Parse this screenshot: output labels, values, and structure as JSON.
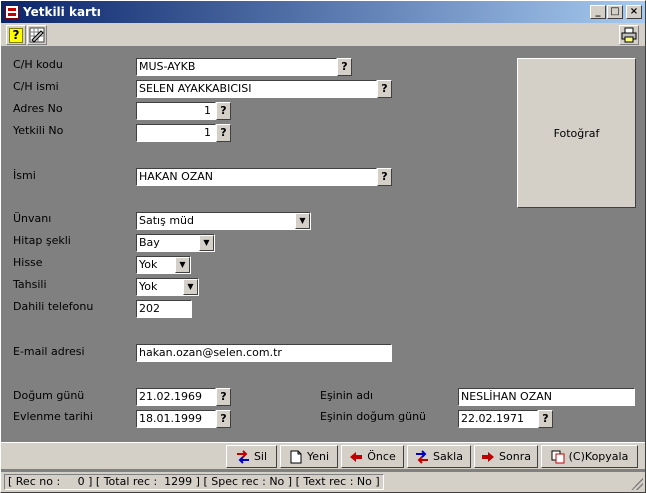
{
  "window": {
    "title": "Yetkili kartı"
  },
  "toolbar": {
    "help_label": "?"
  },
  "form": {
    "ch_kodu_label": "C/H kodu",
    "ch_kodu_value": "MUS-AYKB",
    "ch_ismi_label": "C/H ismi",
    "ch_ismi_value": "SELEN AYAKKABICISI",
    "adres_no_label": "Adres No",
    "adres_no_value": "1",
    "yetkili_no_label": "Yetkili No",
    "yetkili_no_value": "1",
    "isim_label": "İsmi",
    "isim_value": "HAKAN OZAN",
    "unvan_label": "Ünvanı",
    "unvan_value": "Satış müd",
    "hitap_label": "Hitap şekli",
    "hitap_value": "Bay",
    "hisse_label": "Hisse",
    "hisse_value": "Yok",
    "tahsil_label": "Tahsili",
    "tahsil_value": "Yok",
    "dahili_label": "Dahili telefonu",
    "dahili_value": "202",
    "email_label": "E-mail adresi",
    "email_value": "hakan.ozan@selen.com.tr",
    "dogum_label": "Doğum günü",
    "dogum_value": "21.02.1969",
    "evlenme_label": "Evlenme tarihi",
    "evlenme_value": "18.01.1999",
    "esin_adi_label": "Eşinin adı",
    "esin_adi_value": "NESLİHAN OZAN",
    "esin_dogum_label": "Eşinin doğum günü",
    "esin_dogum_value": "22.02.1971",
    "lookup_label": "?",
    "photo_label": "Fotoğraf"
  },
  "actions": {
    "sil": "Sil",
    "yeni": "Yeni",
    "once": "Önce",
    "sakla": "Sakla",
    "sonra": "Sonra",
    "kopyala": "(C)Kopyala"
  },
  "status": {
    "text": "[ Rec no :     0 ] [ Total rec :  1299 ] [ Spec rec : No ] [ Text rec : No ]"
  },
  "colors": {
    "form_bg": "#808080",
    "chrome": "#d4d0c8",
    "title_start": "#0a246a",
    "title_end": "#a6caf0"
  }
}
